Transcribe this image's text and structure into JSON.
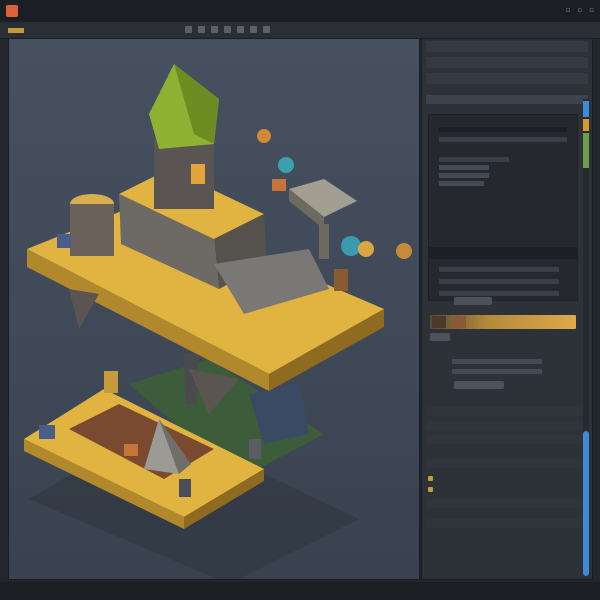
{
  "colors": {
    "accent": "#c79b3a",
    "scroll_accent": "#3d8ad8",
    "island_top": "#e1b340",
    "island_side": "#b2882c",
    "tree_green": "#7fa52a",
    "stone": "#8b8a83"
  },
  "icons": [
    "app-logo-icon",
    "minimize-icon",
    "maximize-icon",
    "close-icon"
  ]
}
